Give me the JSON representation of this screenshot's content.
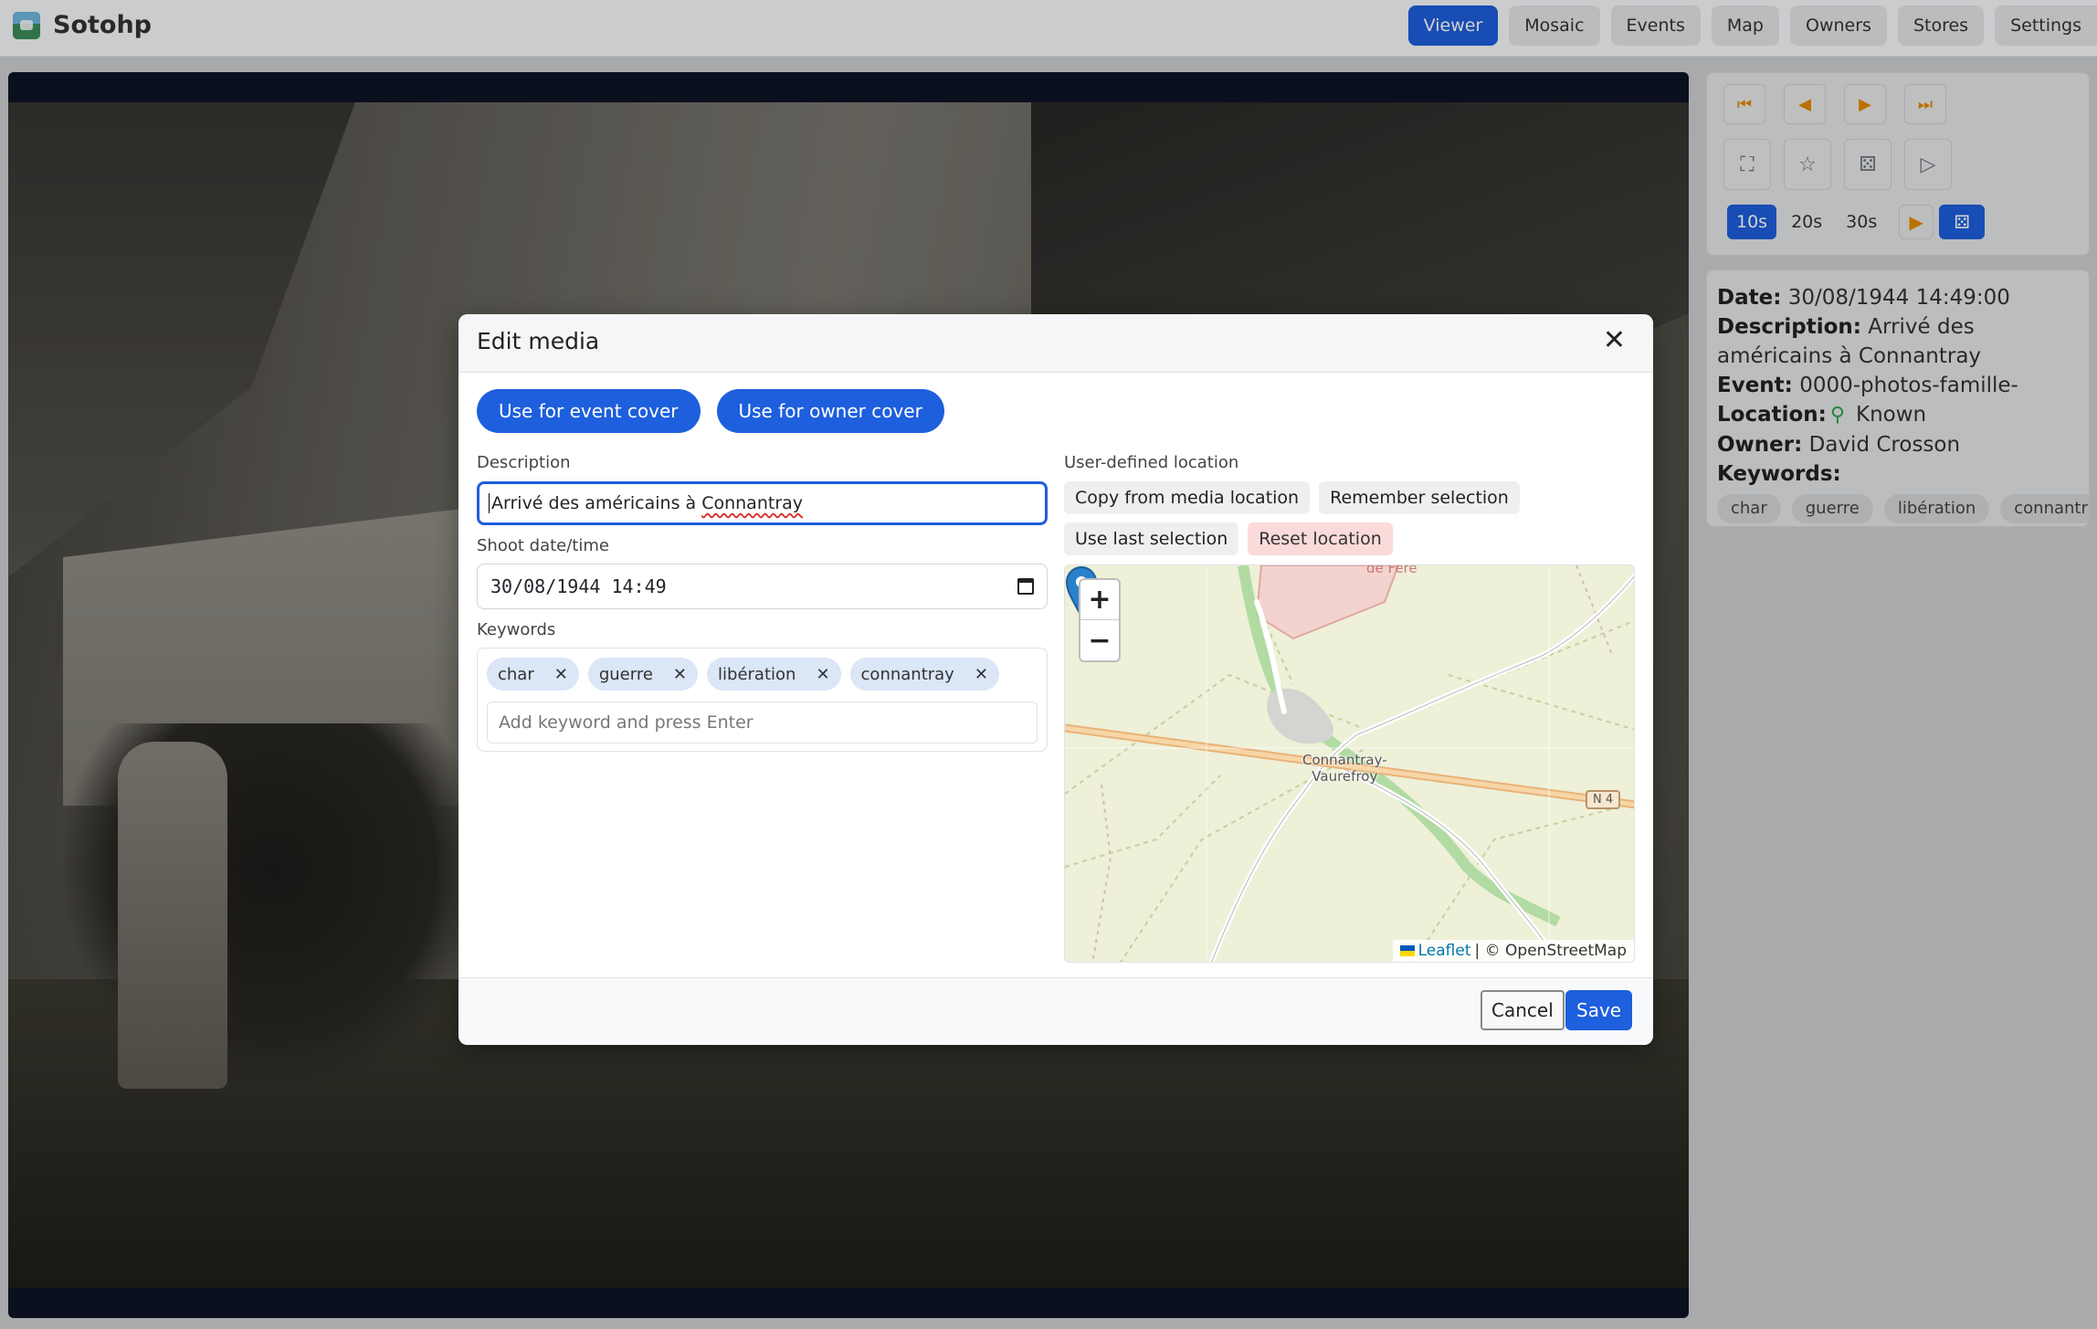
{
  "app": {
    "name": "Sotohp"
  },
  "nav": {
    "items": [
      {
        "label": "Viewer",
        "active": true
      },
      {
        "label": "Mosaic"
      },
      {
        "label": "Events"
      },
      {
        "label": "Map"
      },
      {
        "label": "Owners"
      },
      {
        "label": "Stores"
      },
      {
        "label": "Settings"
      }
    ]
  },
  "controls": {
    "navigation_icons": [
      "first-icon",
      "previous-icon",
      "next-icon",
      "last-icon"
    ],
    "action_icons": [
      "fullscreen-icon",
      "star-icon",
      "dice-icon",
      "play-icon"
    ],
    "durations": [
      "10s",
      "20s",
      "30s"
    ],
    "active_duration": "10s"
  },
  "info": {
    "date_label": "Date:",
    "date_value": "30/08/1944 14:49:00",
    "description_label": "Description:",
    "description_value": "Arrivé des américains à Connantray",
    "event_label": "Event:",
    "event_value": "0000-photos-famille-",
    "location_label": "Location:",
    "location_value": "Known",
    "owner_label": "Owner:",
    "owner_value": "David Crosson",
    "keywords_label": "Keywords:",
    "keywords": [
      "char",
      "guerre",
      "libération",
      "connantray"
    ]
  },
  "modal": {
    "title": "Edit media",
    "event_cover_button": "Use for event cover",
    "owner_cover_button": "Use for owner cover",
    "description_label": "Description",
    "description_prefix": "Arrivé des américains à ",
    "description_misspelled": "Connantray",
    "date_label": "Shoot date/time",
    "date_value": "30/08/1944 14:49",
    "keywords_label": "Keywords",
    "keywords": [
      "char",
      "guerre",
      "libération",
      "connantray"
    ],
    "keyword_placeholder": "Add keyword and press Enter",
    "location_label": "User-defined location",
    "copy_location_button": "Copy from media location",
    "remember_selection_button": "Remember selection",
    "use_last_selection_button": "Use last selection",
    "reset_location_button": "Reset location",
    "map": {
      "zoom_in": "+",
      "zoom_out": "−",
      "town_line1": "Connantray-",
      "town_line2": "Vaurefroy",
      "road_label": "N 4",
      "top_label": "de Fère",
      "attribution_link": "Leaflet",
      "attribution_rest": "| © OpenStreetMap"
    },
    "cancel_button": "Cancel",
    "save_button": "Save"
  },
  "colors": {
    "accent": "#1d5fdc",
    "danger_bg": "#fbdada",
    "chip_bg": "#dbe6f7",
    "orange_icon": "#e58a00"
  }
}
